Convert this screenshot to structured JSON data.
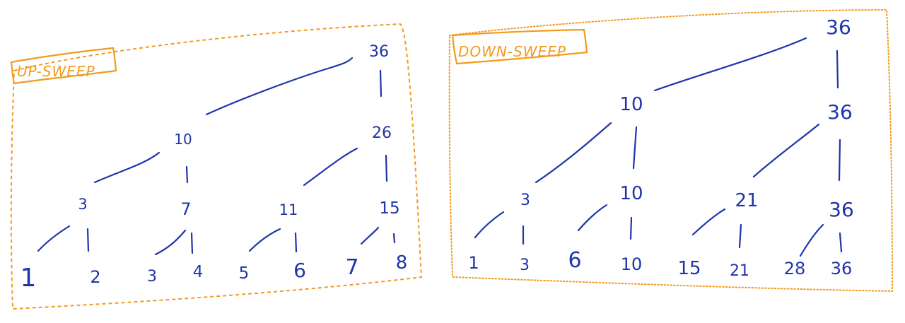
{
  "up_sweep": {
    "label": "UP-SWEEP",
    "nodes": [
      "36",
      "10",
      "26",
      "3",
      "7",
      "11",
      "15",
      "1",
      "2",
      "3",
      "4",
      "5",
      "6",
      "7",
      "8"
    ]
  },
  "down_sweep": {
    "label": "DOWN-SWEEP",
    "nodes": [
      "36",
      "10",
      "36",
      "3",
      "10",
      "21",
      "36",
      "1",
      "3",
      "6",
      "10",
      "15",
      "21",
      "28",
      "36"
    ]
  },
  "colors": {
    "ink": "#1f35a8",
    "accent": "#f39a1e"
  }
}
